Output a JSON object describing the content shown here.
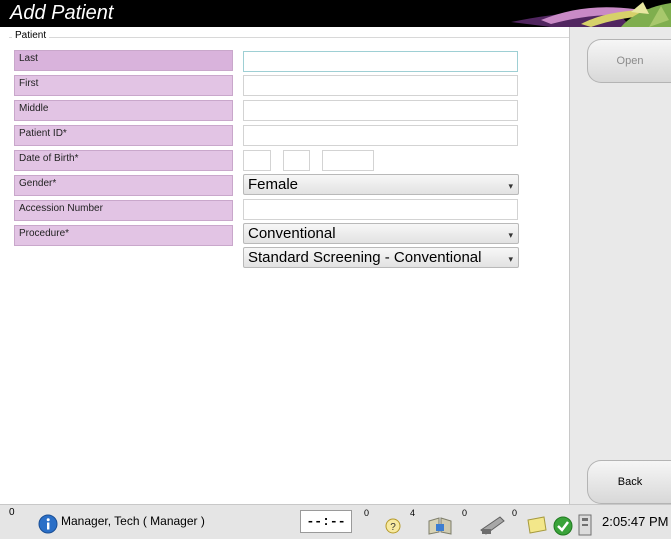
{
  "window": {
    "title": "Add Patient"
  },
  "patient": {
    "legend": "Patient",
    "labels": {
      "last": "Last",
      "first": "First",
      "middle": "Middle",
      "patient_id": "Patient ID*",
      "dob": "Date of Birth*",
      "gender": "Gender*",
      "accession": "Accession Number",
      "procedure": "Procedure*"
    },
    "values": {
      "last": "",
      "first": "",
      "middle": "",
      "patient_id": "",
      "dob_month": "",
      "dob_day": "",
      "dob_year": "",
      "accession": ""
    },
    "gender_selected": "Female",
    "procedure_type_selected": "Conventional",
    "procedure_selected": "Standard Screening - Conventional"
  },
  "right_pane": {
    "open_label": "Open",
    "back_label": "Back"
  },
  "status": {
    "left_count": "0",
    "user": "Manager, Tech ( Manager )",
    "timer": "--:--",
    "timer_count": "0",
    "help_count": "4",
    "queue_count": "0",
    "tube_count": "0",
    "time": "2:05:47 PM"
  },
  "colors": {
    "label_bg": "#e2c4e4",
    "titlebar": "#000000",
    "pane": "#e9e9e9"
  },
  "icons": [
    "info-icon",
    "help-icon",
    "book-icon",
    "tube-icon",
    "notes-icon",
    "check-icon",
    "device-icon"
  ]
}
